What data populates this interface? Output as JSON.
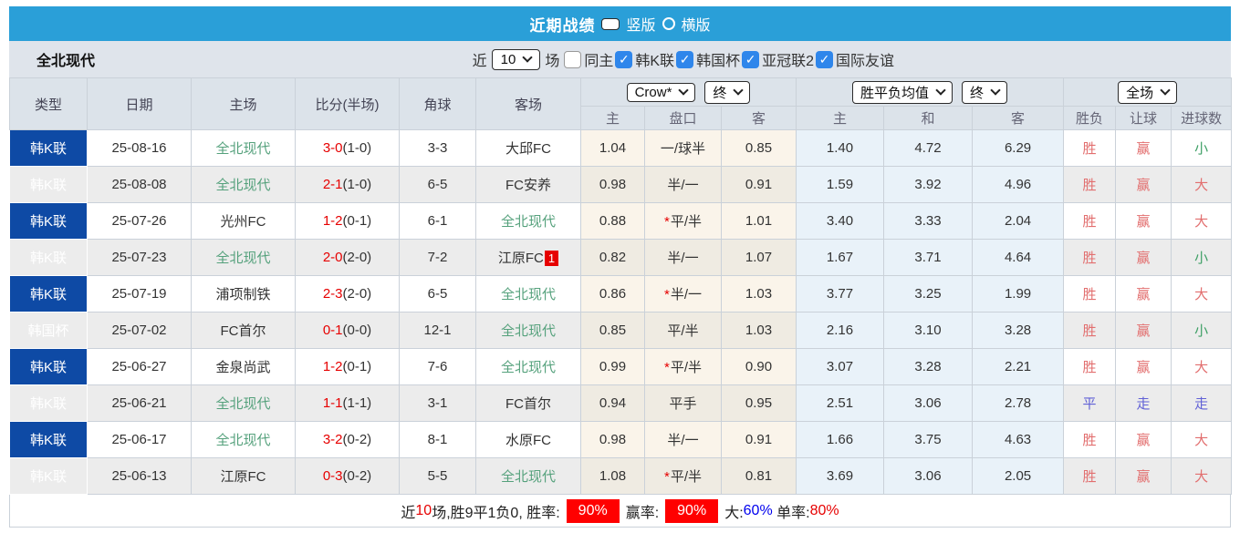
{
  "titlebar": {
    "title": "近期战绩",
    "radios": [
      {
        "label": "竖版",
        "selected": true
      },
      {
        "label": "横版",
        "selected": false
      }
    ]
  },
  "filterbar": {
    "team": "全北现代",
    "near_label": "近",
    "games_value": "10",
    "games_label": "场",
    "checkboxes": [
      {
        "name": "checkbox-same-venue",
        "label": "同主",
        "checked": false
      },
      {
        "name": "checkbox-k-league",
        "label": "韩K联",
        "checked": true
      },
      {
        "name": "checkbox-korean-cup",
        "label": "韩国杯",
        "checked": true
      },
      {
        "name": "checkbox-acl2",
        "label": "亚冠联2",
        "checked": true
      },
      {
        "name": "checkbox-friendly",
        "label": "国际友谊",
        "checked": true
      }
    ]
  },
  "table": {
    "main_headers": [
      "类型",
      "日期",
      "主场",
      "比分(半场)",
      "角球",
      "客场"
    ],
    "selects": {
      "odds_source": "Crow*",
      "odds_time": "终",
      "mean_source": "胜平负均值",
      "mean_time": "终",
      "scope": "全场"
    },
    "sub_headers": [
      "主",
      "盘口",
      "客",
      "主",
      "和",
      "客",
      "胜负",
      "让球",
      "进球数"
    ],
    "rows": [
      {
        "league": "韩K联",
        "league_type": "league",
        "date": "25-08-16",
        "home": "全北现代",
        "home_self": true,
        "score": "3-0",
        "half": "(1-0)",
        "corners": "3-3",
        "away": "大邱FC",
        "away_self": false,
        "away_badge": "",
        "odds_home": "1.04",
        "star": false,
        "handicap": "一/球半",
        "odds_away": "0.85",
        "mean_home": "1.40",
        "mean_draw": "4.72",
        "mean_away": "6.29",
        "result_wdl": "胜",
        "result_handicap": "赢",
        "result_goals": "小",
        "result_colors": [
          "red",
          "red",
          "green"
        ]
      },
      {
        "league": "韩K联",
        "league_type": "league",
        "date": "25-08-08",
        "home": "全北现代",
        "home_self": true,
        "score": "2-1",
        "half": "(1-0)",
        "corners": "6-5",
        "away": "FC安养",
        "away_self": false,
        "away_badge": "",
        "odds_home": "0.98",
        "star": false,
        "handicap": "半/一",
        "odds_away": "0.91",
        "mean_home": "1.59",
        "mean_draw": "3.92",
        "mean_away": "4.96",
        "result_wdl": "胜",
        "result_handicap": "赢",
        "result_goals": "大",
        "result_colors": [
          "red",
          "red",
          "red"
        ]
      },
      {
        "league": "韩K联",
        "league_type": "league",
        "date": "25-07-26",
        "home": "光州FC",
        "home_self": false,
        "score": "1-2",
        "half": "(0-1)",
        "corners": "6-1",
        "away": "全北现代",
        "away_self": true,
        "away_badge": "",
        "odds_home": "0.88",
        "star": true,
        "handicap": "平/半",
        "odds_away": "1.01",
        "mean_home": "3.40",
        "mean_draw": "3.33",
        "mean_away": "2.04",
        "result_wdl": "胜",
        "result_handicap": "赢",
        "result_goals": "大",
        "result_colors": [
          "red",
          "red",
          "red"
        ]
      },
      {
        "league": "韩K联",
        "league_type": "league",
        "date": "25-07-23",
        "home": "全北现代",
        "home_self": true,
        "score": "2-0",
        "half": "(2-0)",
        "corners": "7-2",
        "away": "江原FC",
        "away_self": false,
        "away_badge": "1",
        "odds_home": "0.82",
        "star": false,
        "handicap": "半/一",
        "odds_away": "1.07",
        "mean_home": "1.67",
        "mean_draw": "3.71",
        "mean_away": "4.64",
        "result_wdl": "胜",
        "result_handicap": "赢",
        "result_goals": "小",
        "result_colors": [
          "red",
          "red",
          "green"
        ]
      },
      {
        "league": "韩K联",
        "league_type": "league",
        "date": "25-07-19",
        "home": "浦项制铁",
        "home_self": false,
        "score": "2-3",
        "half": "(2-0)",
        "corners": "6-5",
        "away": "全北现代",
        "away_self": true,
        "away_badge": "",
        "odds_home": "0.86",
        "star": true,
        "handicap": "半/一",
        "odds_away": "1.03",
        "mean_home": "3.77",
        "mean_draw": "3.25",
        "mean_away": "1.99",
        "result_wdl": "胜",
        "result_handicap": "赢",
        "result_goals": "大",
        "result_colors": [
          "red",
          "red",
          "red"
        ]
      },
      {
        "league": "韩国杯",
        "league_type": "cup",
        "date": "25-07-02",
        "home": "FC首尔",
        "home_self": false,
        "score": "0-1",
        "half": "(0-0)",
        "corners": "12-1",
        "away": "全北现代",
        "away_self": true,
        "away_badge": "",
        "odds_home": "0.85",
        "star": false,
        "handicap": "平/半",
        "odds_away": "1.03",
        "mean_home": "2.16",
        "mean_draw": "3.10",
        "mean_away": "3.28",
        "result_wdl": "胜",
        "result_handicap": "赢",
        "result_goals": "小",
        "result_colors": [
          "red",
          "red",
          "green"
        ]
      },
      {
        "league": "韩K联",
        "league_type": "league",
        "date": "25-06-27",
        "home": "金泉尚武",
        "home_self": false,
        "score": "1-2",
        "half": "(0-1)",
        "corners": "7-6",
        "away": "全北现代",
        "away_self": true,
        "away_badge": "",
        "odds_home": "0.99",
        "star": true,
        "handicap": "平/半",
        "odds_away": "0.90",
        "mean_home": "3.07",
        "mean_draw": "3.28",
        "mean_away": "2.21",
        "result_wdl": "胜",
        "result_handicap": "赢",
        "result_goals": "大",
        "result_colors": [
          "red",
          "red",
          "red"
        ]
      },
      {
        "league": "韩K联",
        "league_type": "league",
        "date": "25-06-21",
        "home": "全北现代",
        "home_self": true,
        "score": "1-1",
        "half": "(1-1)",
        "corners": "3-1",
        "away": "FC首尔",
        "away_self": false,
        "away_badge": "",
        "odds_home": "0.94",
        "star": false,
        "handicap": "平手",
        "odds_away": "0.95",
        "mean_home": "2.51",
        "mean_draw": "3.06",
        "mean_away": "2.78",
        "result_wdl": "平",
        "result_handicap": "走",
        "result_goals": "走",
        "result_colors": [
          "blue",
          "blue",
          "blue"
        ]
      },
      {
        "league": "韩K联",
        "league_type": "league",
        "date": "25-06-17",
        "home": "全北现代",
        "home_self": true,
        "score": "3-2",
        "half": "(0-2)",
        "corners": "8-1",
        "away": "水原FC",
        "away_self": false,
        "away_badge": "",
        "odds_home": "0.98",
        "star": false,
        "handicap": "半/一",
        "odds_away": "0.91",
        "mean_home": "1.66",
        "mean_draw": "3.75",
        "mean_away": "4.63",
        "result_wdl": "胜",
        "result_handicap": "赢",
        "result_goals": "大",
        "result_colors": [
          "red",
          "red",
          "red"
        ]
      },
      {
        "league": "韩K联",
        "league_type": "league",
        "date": "25-06-13",
        "home": "江原FC",
        "home_self": false,
        "score": "0-3",
        "half": "(0-2)",
        "corners": "5-5",
        "away": "全北现代",
        "away_self": true,
        "away_badge": "",
        "odds_home": "1.08",
        "star": true,
        "handicap": "平/半",
        "odds_away": "0.81",
        "mean_home": "3.69",
        "mean_draw": "3.06",
        "mean_away": "2.05",
        "result_wdl": "胜",
        "result_handicap": "赢",
        "result_goals": "大",
        "result_colors": [
          "red",
          "red",
          "red"
        ]
      }
    ]
  },
  "summary": {
    "near_label": "近",
    "games": "10",
    "record_text": "场,胜9平1负0, 胜率:",
    "rate1": "90%",
    "rate2_label": "赢率:",
    "rate2": "90%",
    "big_label": "大:",
    "big_value": "60%",
    "single_label": " 单率:",
    "single_value": "80%"
  },
  "colors": {
    "titlebar_bg": "#2A9FD8",
    "league_badge_blue": "#0E4AA5",
    "cup_badge_purple": "#3A10C9",
    "focus_team_green": "#55A17C",
    "score_red": "#E60000",
    "win_red": "#E26E6E",
    "under_green": "#3FA066",
    "draw_blue": "#6161D6",
    "checkbox_blue": "#2F86EB",
    "rate_box_bg": "#FF0000",
    "big_pct_blue": "#0000EE"
  }
}
